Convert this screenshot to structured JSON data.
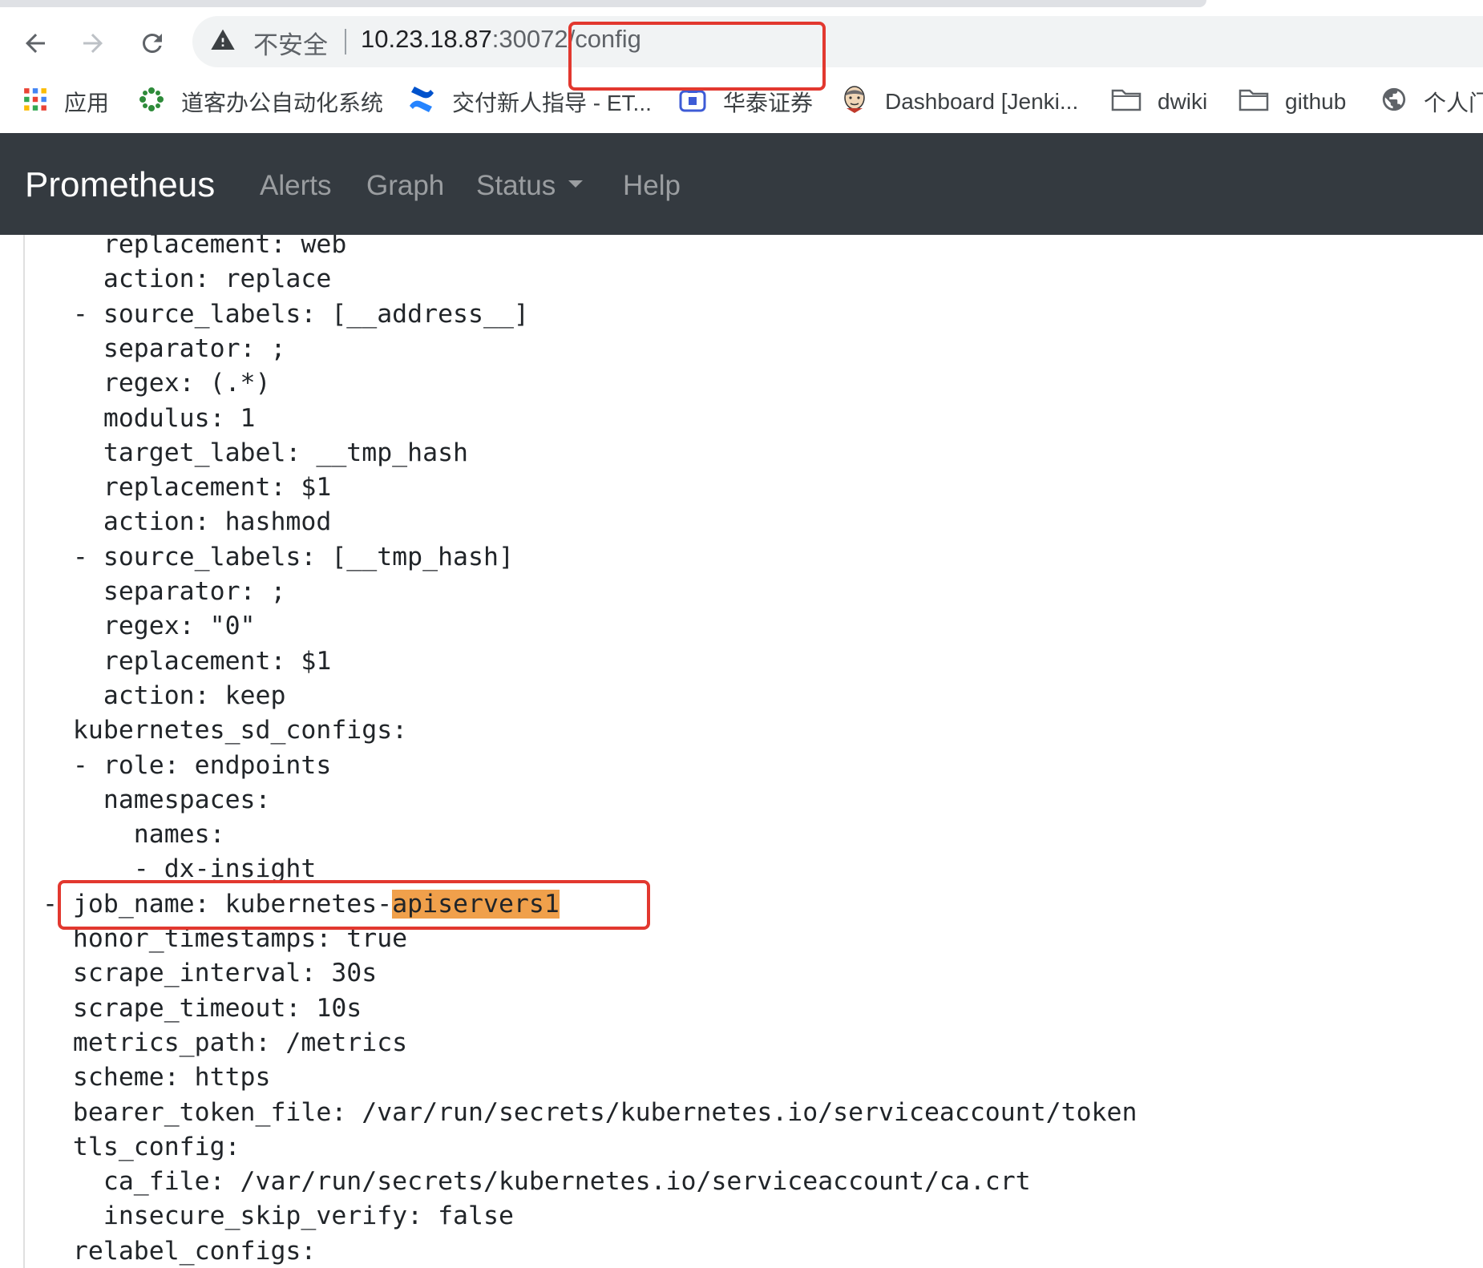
{
  "browser": {
    "insecure_label": "不安全",
    "url_host": "10.23.18.87",
    "url_rest": ":30072/config"
  },
  "bookmarks": [
    {
      "label": "应用",
      "icon": "apps-grid-icon"
    },
    {
      "label": "道客办公自动化系统",
      "icon": "daoke-logo-icon"
    },
    {
      "label": "交付新人指导 - ET...",
      "icon": "confluence-icon"
    },
    {
      "label": "华泰证券",
      "icon": "huatai-icon"
    },
    {
      "label": "Dashboard [Jenki...",
      "icon": "jenkins-icon"
    },
    {
      "label": "dwiki",
      "icon": "folder-icon"
    },
    {
      "label": "github",
      "icon": "folder-icon"
    },
    {
      "label": "个人门",
      "icon": "globe-icon"
    }
  ],
  "prometheus_nav": {
    "brand": "Prometheus",
    "links": [
      "Alerts",
      "Graph",
      "Status",
      "Help"
    ]
  },
  "config_lines": [
    {
      "text": "    replacement: web"
    },
    {
      "text": "    action: replace"
    },
    {
      "text": "  - source_labels: [__address__]"
    },
    {
      "text": "    separator: ;"
    },
    {
      "text": "    regex: (.*)"
    },
    {
      "text": "    modulus: 1"
    },
    {
      "text": "    target_label: __tmp_hash"
    },
    {
      "text": "    replacement: $1"
    },
    {
      "text": "    action: hashmod"
    },
    {
      "text": "  - source_labels: [__tmp_hash]"
    },
    {
      "text": "    separator: ;"
    },
    {
      "text": "    regex: \"0\""
    },
    {
      "text": "    replacement: $1"
    },
    {
      "text": "    action: keep"
    },
    {
      "text": "  kubernetes_sd_configs:"
    },
    {
      "text": "  - role: endpoints"
    },
    {
      "text": "    namespaces:"
    },
    {
      "text": "      names:"
    },
    {
      "text": "      - dx-insight"
    },
    {
      "text": "- job_name: kubernetes-",
      "highlight": "apiservers1"
    },
    {
      "text": "  honor_timestamps: true"
    },
    {
      "text": "  scrape_interval: 30s"
    },
    {
      "text": "  scrape_timeout: 10s"
    },
    {
      "text": "  metrics_path: /metrics"
    },
    {
      "text": "  scheme: https"
    },
    {
      "text": "  bearer_token_file: /var/run/secrets/kubernetes.io/serviceaccount/token"
    },
    {
      "text": "  tls_config:"
    },
    {
      "text": "    ca_file: /var/run/secrets/kubernetes.io/serviceaccount/ca.crt"
    },
    {
      "text": "    insecure_skip_verify: false"
    },
    {
      "text": "  relabel_configs:"
    }
  ],
  "colors": {
    "navbar_bg": "#343a40",
    "highlight_bg": "#f0a04b",
    "annotation_red": "#e2382f"
  }
}
